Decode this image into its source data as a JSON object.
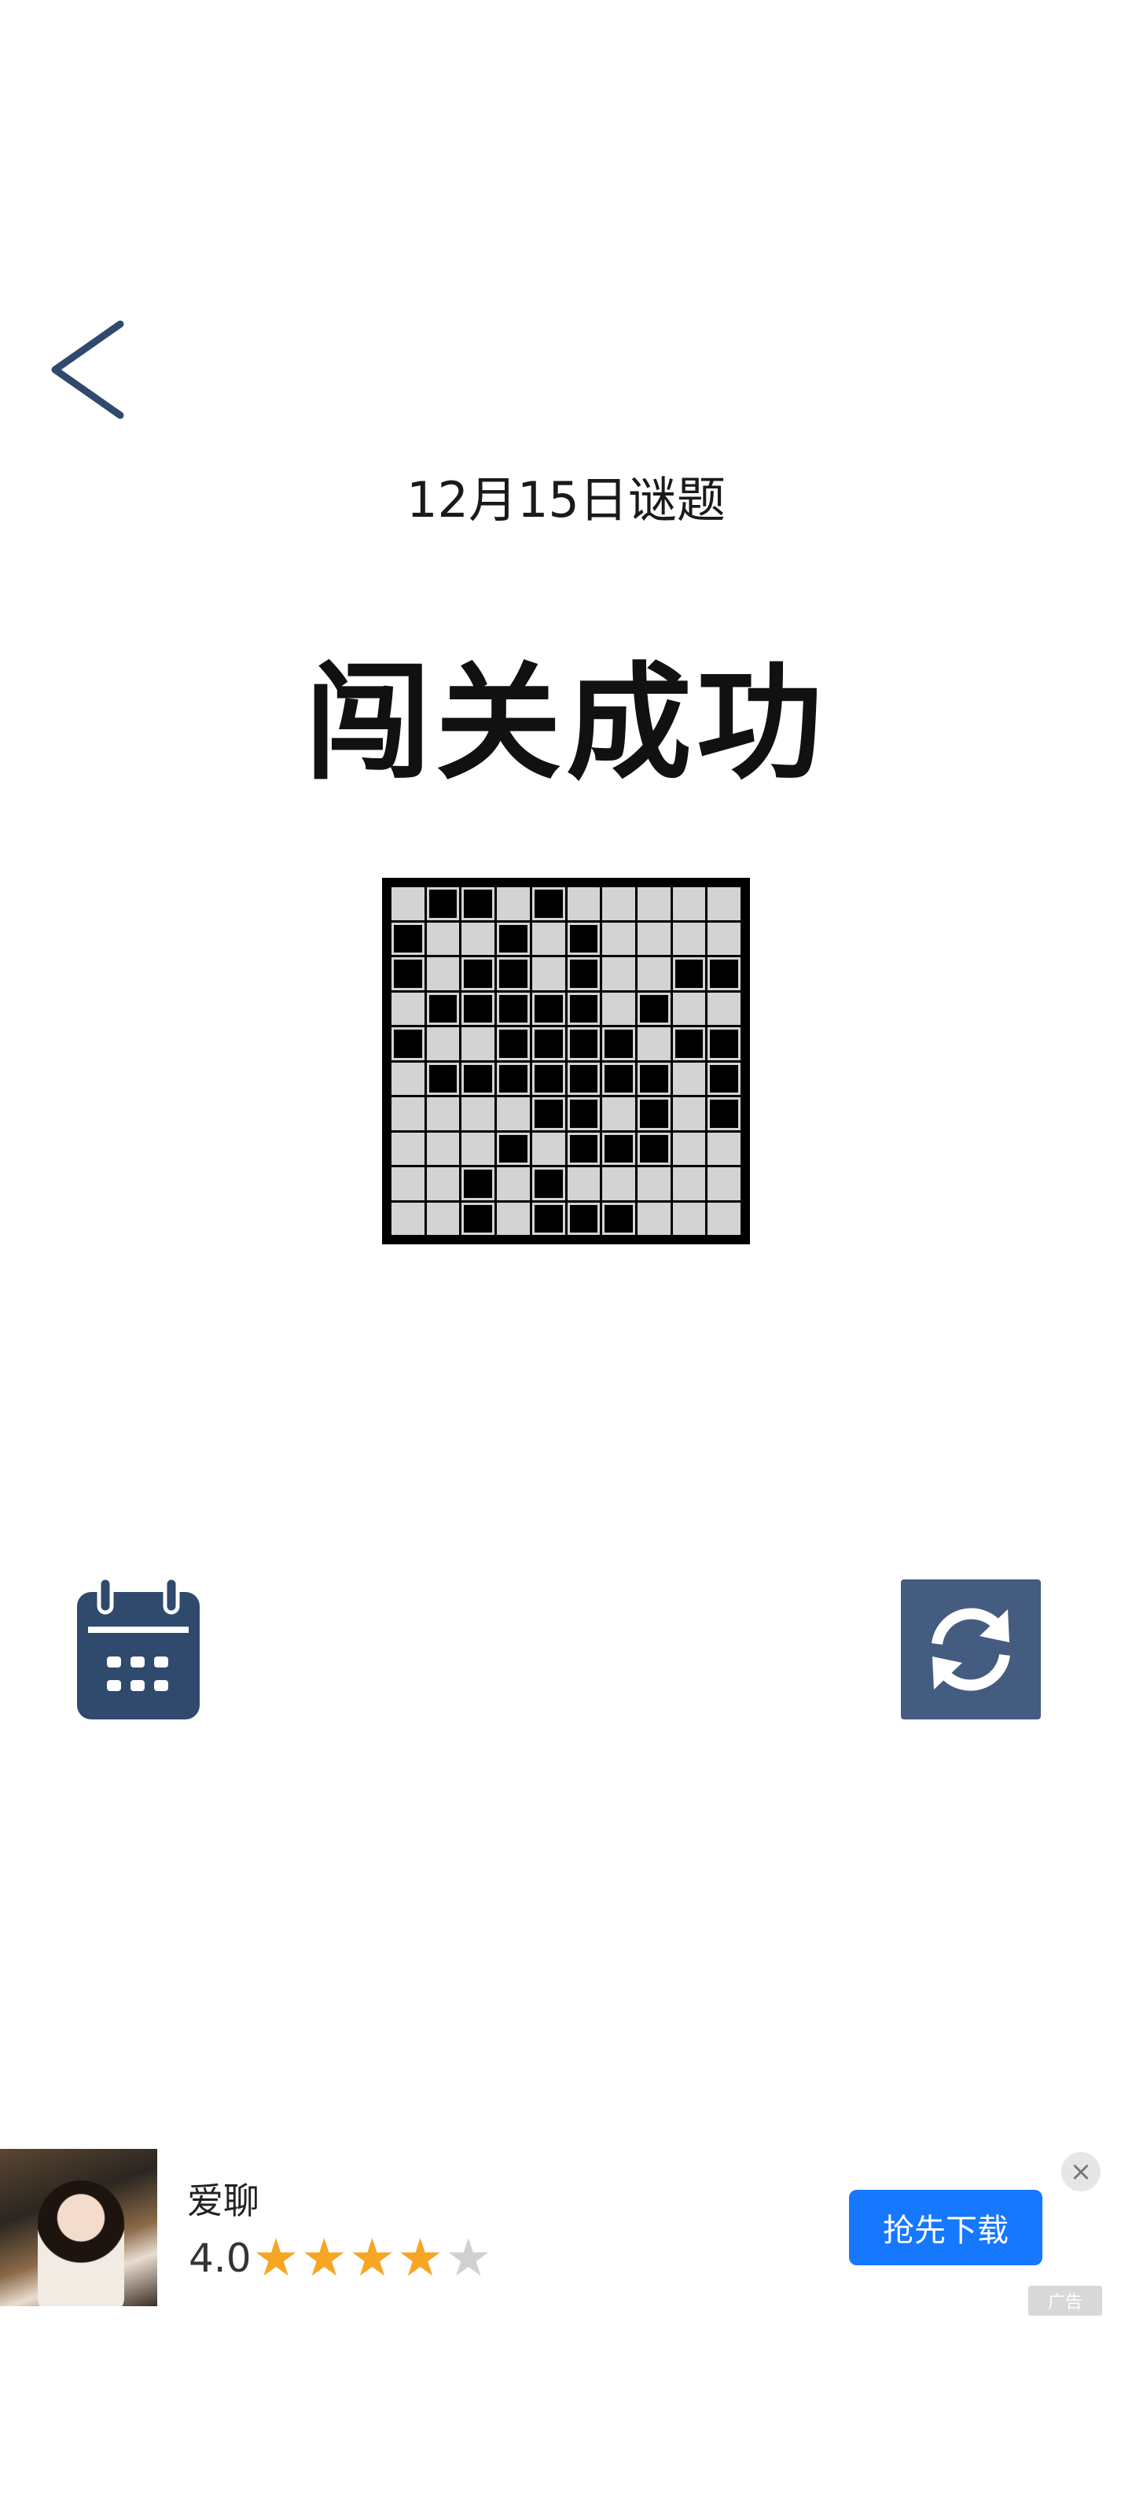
{
  "header": {
    "back_icon": "chevron-left-icon",
    "puzzle_date": "12月15日谜题",
    "result_title": "闯关成功"
  },
  "board": {
    "rows": 10,
    "cols": 10,
    "cell_color": "#d3d3d3",
    "filled_color": "#000000",
    "cells": [
      [
        0,
        1,
        1,
        0,
        1,
        0,
        0,
        0,
        0,
        0
      ],
      [
        1,
        0,
        0,
        1,
        0,
        1,
        0,
        0,
        0,
        0
      ],
      [
        1,
        0,
        1,
        1,
        0,
        1,
        0,
        0,
        1,
        1
      ],
      [
        0,
        1,
        1,
        1,
        1,
        1,
        0,
        1,
        0,
        0
      ],
      [
        1,
        0,
        0,
        1,
        1,
        1,
        1,
        0,
        1,
        1
      ],
      [
        0,
        1,
        1,
        1,
        1,
        1,
        1,
        1,
        0,
        1
      ],
      [
        0,
        0,
        0,
        0,
        1,
        1,
        0,
        1,
        0,
        1
      ],
      [
        0,
        0,
        0,
        1,
        0,
        1,
        1,
        1,
        0,
        0
      ],
      [
        0,
        0,
        1,
        0,
        1,
        0,
        0,
        0,
        0,
        0
      ],
      [
        0,
        0,
        1,
        0,
        1,
        1,
        1,
        0,
        0,
        0
      ]
    ]
  },
  "toolbar": {
    "calendar_icon": "calendar-icon",
    "refresh_icon": "refresh-icon",
    "accent_color": "#445c80"
  },
  "ad": {
    "app_name": "爱聊",
    "rating": "4.0",
    "stars_filled": 4,
    "stars_total": 5,
    "cta_label": "抢先下载",
    "close_icon": "close-icon",
    "ad_tag": "广告",
    "cta_color": "#1677ff"
  }
}
